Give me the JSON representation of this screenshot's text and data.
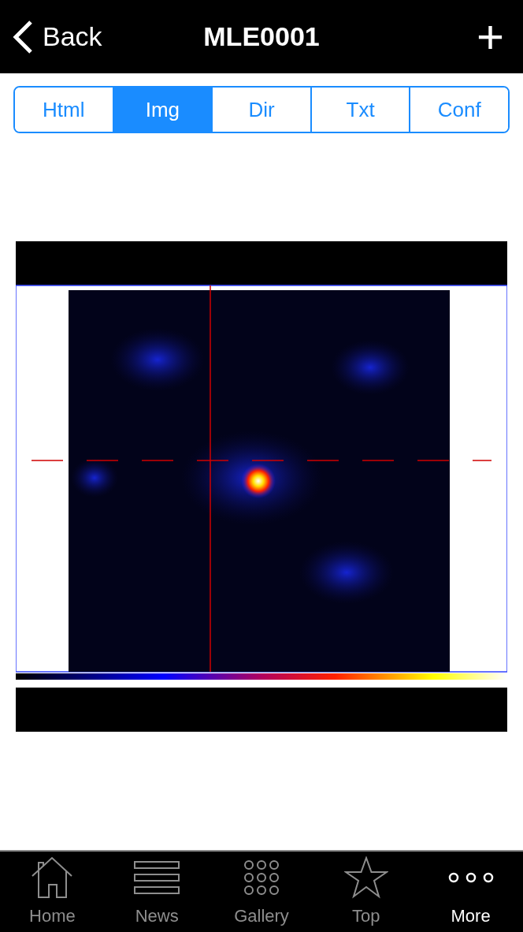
{
  "nav": {
    "back": "Back",
    "title": "MLE0001",
    "add": "+"
  },
  "segments": [
    {
      "label": "Html",
      "selected": false
    },
    {
      "label": "Img",
      "selected": true
    },
    {
      "label": "Dir",
      "selected": false
    },
    {
      "label": "Txt",
      "selected": false
    },
    {
      "label": "Conf",
      "selected": false
    }
  ],
  "tab_bar": [
    {
      "label": "Home",
      "kind": "home",
      "selected": false
    },
    {
      "label": "News",
      "kind": "news",
      "selected": false
    },
    {
      "label": "Gallery",
      "kind": "gallery",
      "selected": false
    },
    {
      "label": "Top",
      "kind": "star",
      "selected": false
    },
    {
      "label": "More",
      "kind": "more",
      "selected": true
    }
  ]
}
